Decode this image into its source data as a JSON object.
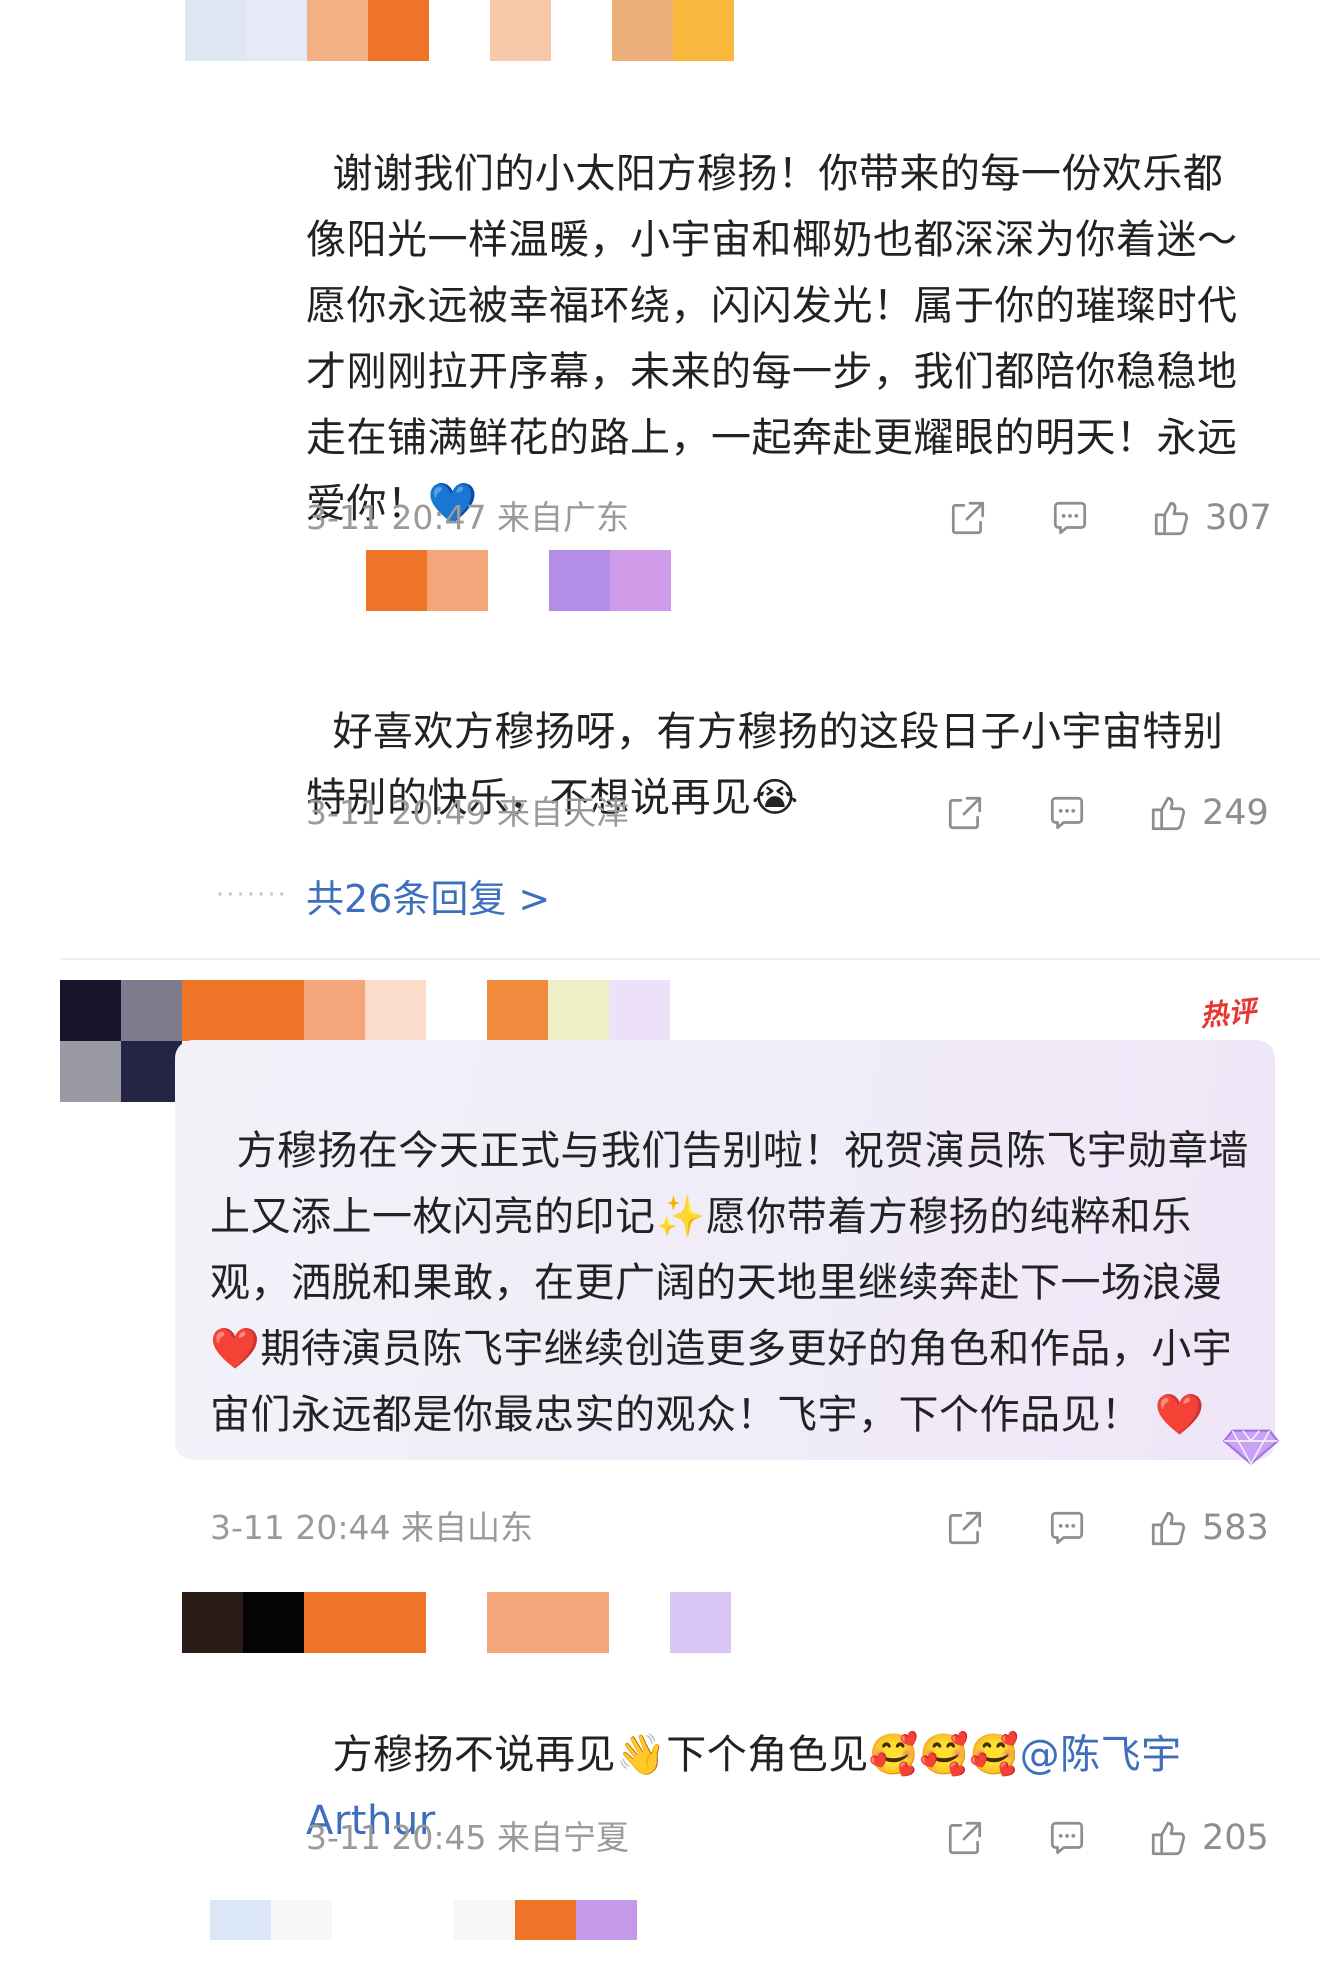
{
  "colors": {
    "accent": "#3e6fbc",
    "meta": "#9a9a9a",
    "hot": "#e8352f"
  },
  "comments": [
    {
      "id": "c1",
      "pixels": [
        [
          "#dfe6f4",
          "#e6eaf6",
          "#f4b085",
          "#f07427",
          "#ffffff",
          "#f9c8a8",
          "#ffffff",
          "#eeb07a",
          "#f9b73e"
        ]
      ],
      "text": "谢谢我们的小太阳方穆扬！你带来的每一份欢乐都像阳光一样温暖，小宇宙和椰奶也都深深为你着迷～愿你永远被幸福环绕，闪闪发光！属于你的璀璨时代才刚刚拉开序幕，未来的每一步，我们都陪你稳稳地走在铺满鲜花的路上，一起奔赴更耀眼的明天！永远爱你！",
      "emoji": "💙",
      "time": "3-11 20:47",
      "location": "来自广东",
      "likes": "307"
    },
    {
      "id": "c2",
      "pixels": [
        [
          "#f07427",
          "#f4a57a",
          "#ffffff",
          "#b28ee8",
          "#cf9ae8"
        ]
      ],
      "text": "好喜欢方穆扬呀，有方穆扬的这段日子小宇宙特别特别的快乐，不想说再见",
      "emoji": "😭",
      "time": "3-11 20:49",
      "location": "来自天津",
      "likes": "249"
    },
    {
      "id": "c3",
      "hot_label": "热评",
      "text": "方穆扬在今天正式与我们告别啦！祝贺演员陈飞宇勋章墙上又添上一枚闪亮的印记",
      "emoji_sparkle": "✨",
      "text_2": "愿你带着方穆扬的纯粹和乐观，洒脱和果敢，在更广阔的天地里继续奔赴下一场浪漫",
      "emoji_heart": "❤️",
      "text_3": "期待演员陈飞宇继续创造更多更好的角色和作品，小宇宙们永远都是你最忠实的观众！飞宇，下个作品见！",
      "emoji_end": "❤️",
      "time": "3-11 20:44",
      "location": "来自山东",
      "likes": "583"
    },
    {
      "id": "c4",
      "text": "方穆扬不说再见",
      "emoji_wave": "👋",
      "text_2": "下个角色见",
      "emoji_hug": "🥰🥰🥰",
      "mention": "@陈飞宇 Arthur",
      "time": "3-11 20:45",
      "location": "来自宁夏",
      "likes": "205"
    }
  ],
  "more_replies": "共26条回复 >",
  "more_dots": "·······"
}
